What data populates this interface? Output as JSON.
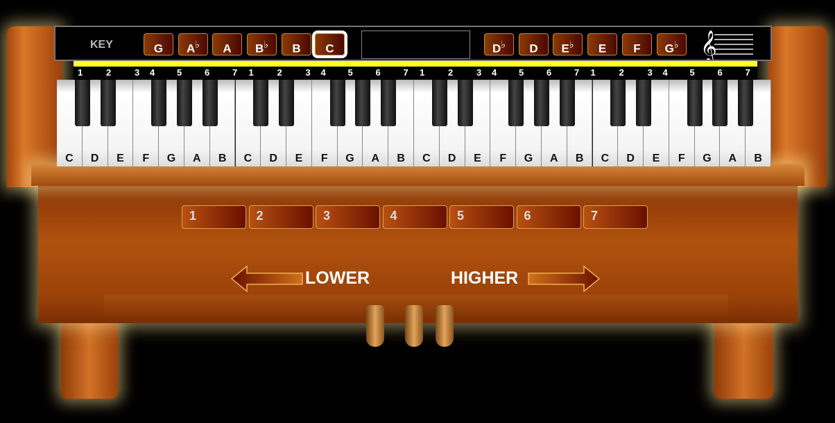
{
  "key_selector": {
    "label": "KEY",
    "keys": [
      {
        "note": "G",
        "flat": ""
      },
      {
        "note": "A",
        "flat": "♭"
      },
      {
        "note": "A",
        "flat": ""
      },
      {
        "note": "B",
        "flat": "♭"
      },
      {
        "note": "B",
        "flat": ""
      },
      {
        "note": "C",
        "flat": "",
        "selected": true
      },
      {
        "note": "D",
        "flat": "♭"
      },
      {
        "note": "D",
        "flat": ""
      },
      {
        "note": "E",
        "flat": "♭"
      },
      {
        "note": "E",
        "flat": ""
      },
      {
        "note": "F",
        "flat": ""
      },
      {
        "note": "G",
        "flat": "♭"
      }
    ],
    "display": ""
  },
  "scale_numbers": [
    "1",
    "2",
    "3",
    "4",
    "5",
    "6",
    "7"
  ],
  "white_keys": [
    "C",
    "D",
    "E",
    "F",
    "G",
    "A",
    "B",
    "C",
    "D",
    "E",
    "F",
    "G",
    "A",
    "B",
    "C",
    "D",
    "E",
    "F",
    "G",
    "A",
    "B",
    "C",
    "D",
    "E",
    "F",
    "G",
    "A",
    "B"
  ],
  "octave_buttons": [
    "1",
    "2",
    "3",
    "4",
    "5",
    "6",
    "7"
  ],
  "lower_label": "LOWER",
  "higher_label": "HIGHER",
  "colors": {
    "highlight": "#ffff2a",
    "button": "#8a3a06"
  }
}
